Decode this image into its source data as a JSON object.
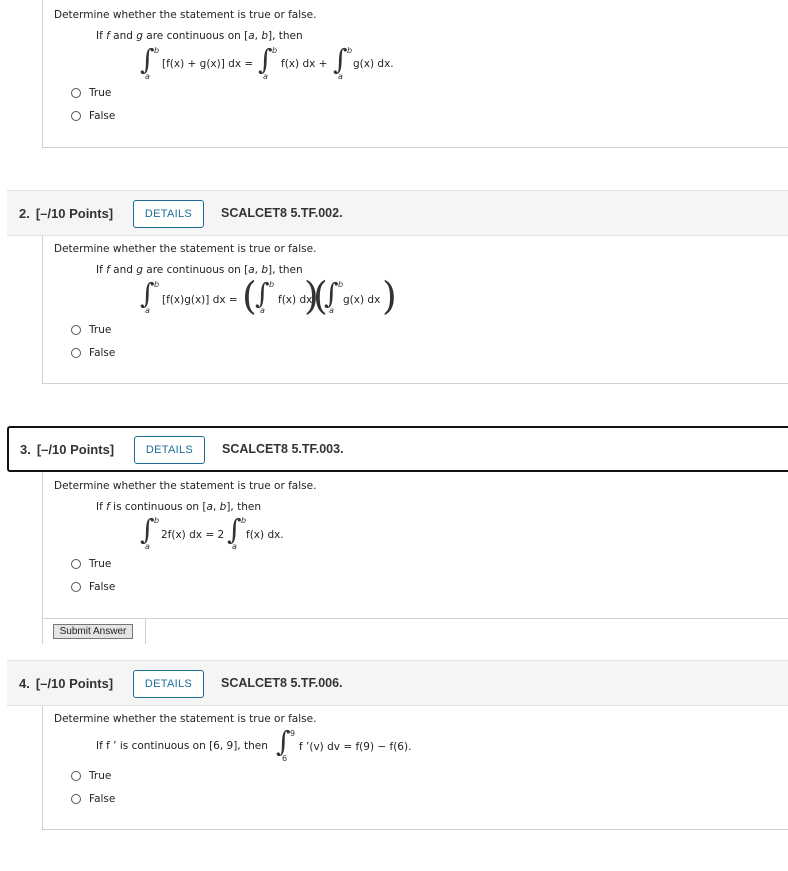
{
  "instruction": "Determine whether the statement is true or false.",
  "options": [
    "True",
    "False"
  ],
  "questions": [
    {
      "condition_pre": "If ",
      "f": "f",
      "and": " and ",
      "g": "g",
      "condition_post": " are continuous on [",
      "a": "a",
      "b": "b",
      "then": "], then",
      "eq": {
        "lower": "a",
        "upper": "b",
        "lhs": "[f(x) + g(x)] dx =",
        "t1": "f(x) dx +",
        "t2": "g(x) dx."
      }
    },
    {
      "number": "2.",
      "points": "[–/10 Points]",
      "details": "DETAILS",
      "code": "SCALCET8 5.TF.002.",
      "condition_pre": "If ",
      "f": "f",
      "and": " and ",
      "g": "g",
      "condition_post": " are continuous on [",
      "a": "a",
      "b": "b",
      "then": "], then",
      "eq": {
        "lower": "a",
        "upper": "b",
        "lhs": "[f(x)g(x)] dx =",
        "t1": "f(x) dx",
        "t2": "g(x) dx",
        "end": "."
      }
    },
    {
      "number": "3.",
      "points": "[–/10 Points]",
      "details": "DETAILS",
      "code": "SCALCET8 5.TF.003.",
      "condition_pre": "If ",
      "f": "f",
      "condition_post": " is continuous on [",
      "a": "a",
      "b": "b",
      "then": "], then",
      "eq": {
        "lower": "a",
        "upper": "b",
        "lhs": "2f(x) dx = 2",
        "t1": "f(x) dx."
      },
      "submit": "Submit Answer"
    },
    {
      "number": "4.",
      "points": "[–/10 Points]",
      "details": "DETAILS",
      "code": "SCALCET8 5.TF.006.",
      "condition": "If f ’ is continuous on [6, 9], then",
      "eq": {
        "lower": "6",
        "upper": "9",
        "body": "f ’(v) dv = f(9) − f(6)."
      }
    }
  ]
}
